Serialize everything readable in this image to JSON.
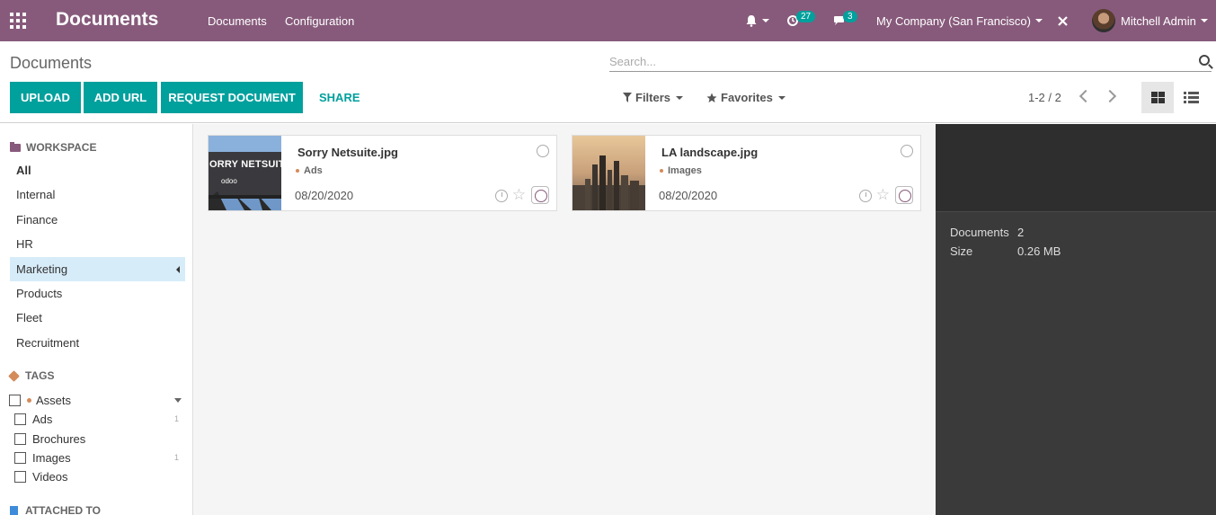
{
  "navbar": {
    "brand": "Documents",
    "menus": [
      "Documents",
      "Configuration"
    ],
    "activity_badge": "27",
    "messages_badge": "3",
    "company": "My Company (San Francisco)",
    "user": "Mitchell Admin"
  },
  "control_panel": {
    "breadcrumb": "Documents",
    "search_placeholder": "Search...",
    "buttons": {
      "upload": "UPLOAD",
      "add_url": "ADD URL",
      "request": "REQUEST DOCUMENT",
      "share": "SHARE"
    },
    "filters_label": "Filters",
    "favorites_label": "Favorites",
    "pager": "1-2 / 2"
  },
  "sidebar": {
    "workspace_title": "WORKSPACE",
    "workspaces": [
      "All",
      "Internal",
      "Finance",
      "HR",
      "Marketing",
      "Products",
      "Fleet",
      "Recruitment"
    ],
    "selected_workspace": "Marketing",
    "tags_title": "TAGS",
    "tag_group": "Assets",
    "tags": [
      {
        "label": "Ads",
        "count": "1"
      },
      {
        "label": "Brochures",
        "count": ""
      },
      {
        "label": "Images",
        "count": "1"
      },
      {
        "label": "Videos",
        "count": ""
      }
    ],
    "attached_title": "ATTACHED TO"
  },
  "documents": [
    {
      "name": "Sorry Netsuite.jpg",
      "tag": "Ads",
      "date": "08/20/2020",
      "thumb_text": "ORRY NETSUIT",
      "thumb_logo": "odoo"
    },
    {
      "name": "LA landscape.jpg",
      "tag": "Images",
      "date": "08/20/2020"
    }
  ],
  "inspector": {
    "rows": [
      {
        "label": "Documents",
        "value": "2"
      },
      {
        "label": "Size",
        "value": "0.26 MB"
      }
    ]
  },
  "colors": {
    "brand": "#875a7b",
    "accent": "#00a09d",
    "selection": "#d7ecf9",
    "inspector": "#3a3a3a"
  }
}
